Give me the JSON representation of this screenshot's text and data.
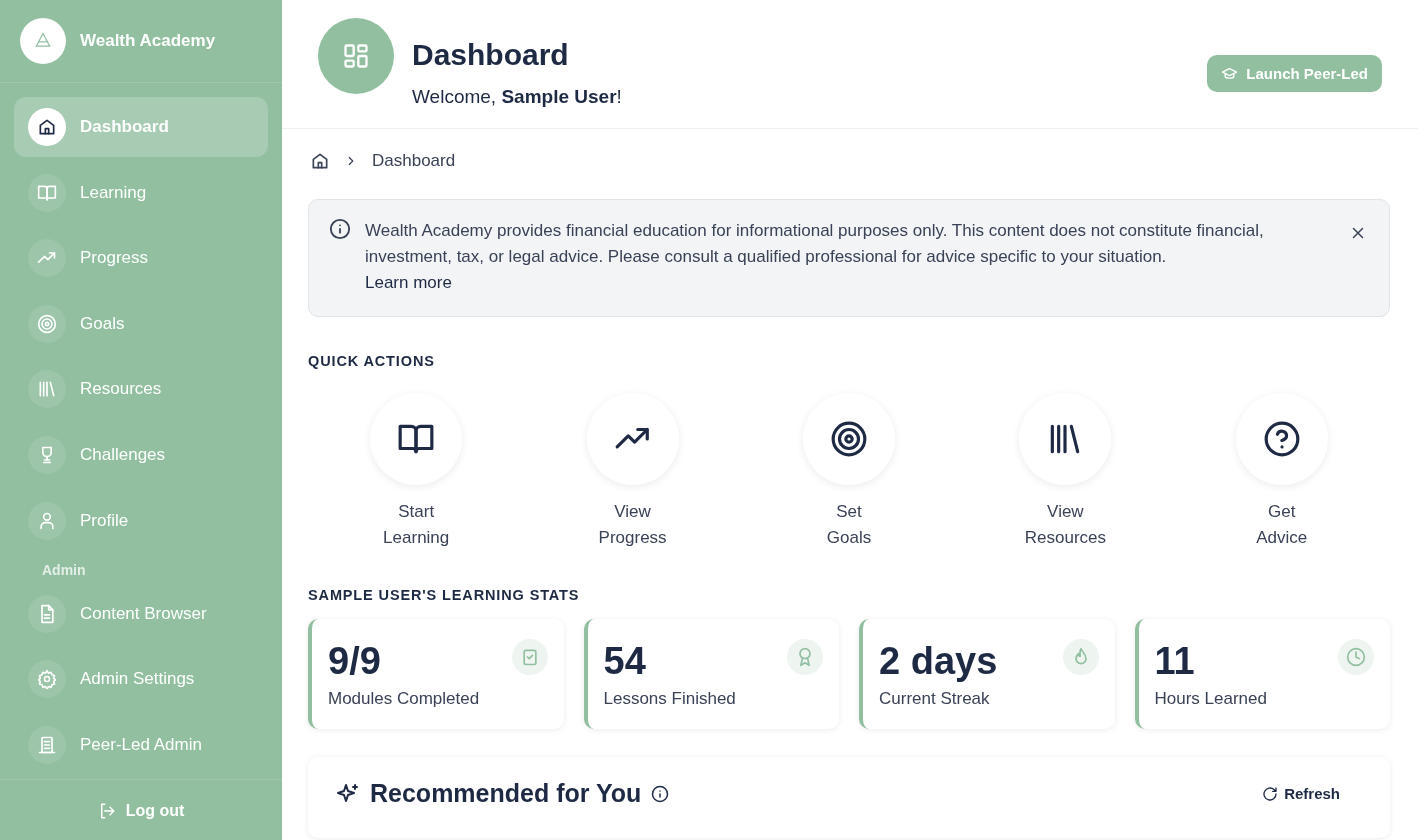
{
  "brand": {
    "name": "Wealth Academy"
  },
  "nav": [
    {
      "label": "Dashboard",
      "selected": true
    },
    {
      "label": "Learning",
      "selected": false
    },
    {
      "label": "Progress",
      "selected": false
    },
    {
      "label": "Goals",
      "selected": false
    },
    {
      "label": "Resources",
      "selected": false
    },
    {
      "label": "Challenges",
      "selected": false
    },
    {
      "label": "Profile",
      "selected": false
    }
  ],
  "admin": {
    "heading": "Admin",
    "items": [
      {
        "label": "Content Browser",
        "selected": false
      },
      {
        "label": "Admin Settings",
        "selected": false
      },
      {
        "label": "Peer-Led Admin",
        "selected": false
      }
    ]
  },
  "logout": "Log out",
  "header": {
    "title": "Dashboard",
    "welcome": "Welcome, **Sample User**!",
    "button": "Launch Peer-Led"
  },
  "breadcrumb": [
    "Dashboard"
  ],
  "notice": {
    "text": "Wealth Academy provides financial education for informational purposes only. This content does not constitute financial, investment, tax, or legal advice. Please consult a qualified professional for advice specific to your situation.",
    "link": "Learn more"
  },
  "quick_actions": {
    "heading": "QUICK ACTIONS",
    "items": [
      {
        "line1": "Start",
        "line2": "Learning"
      },
      {
        "line1": "View",
        "line2": "Progress"
      },
      {
        "line1": "Set",
        "line2": "Goals"
      },
      {
        "line1": "View",
        "line2": "Resources"
      },
      {
        "line1": "Get",
        "line2": "Advice"
      }
    ]
  },
  "stats": {
    "heading": "SAMPLE USER'S LEARNING STATS",
    "items": [
      {
        "value": "9/9",
        "label": "Modules Completed"
      },
      {
        "value": "54",
        "label": "Lessons Finished"
      },
      {
        "value": "2 days",
        "label": "Current Streak"
      },
      {
        "value": "11",
        "label": "Hours Learned"
      }
    ]
  },
  "recommended": {
    "title": "Recommended for You",
    "refresh": "Refresh"
  }
}
